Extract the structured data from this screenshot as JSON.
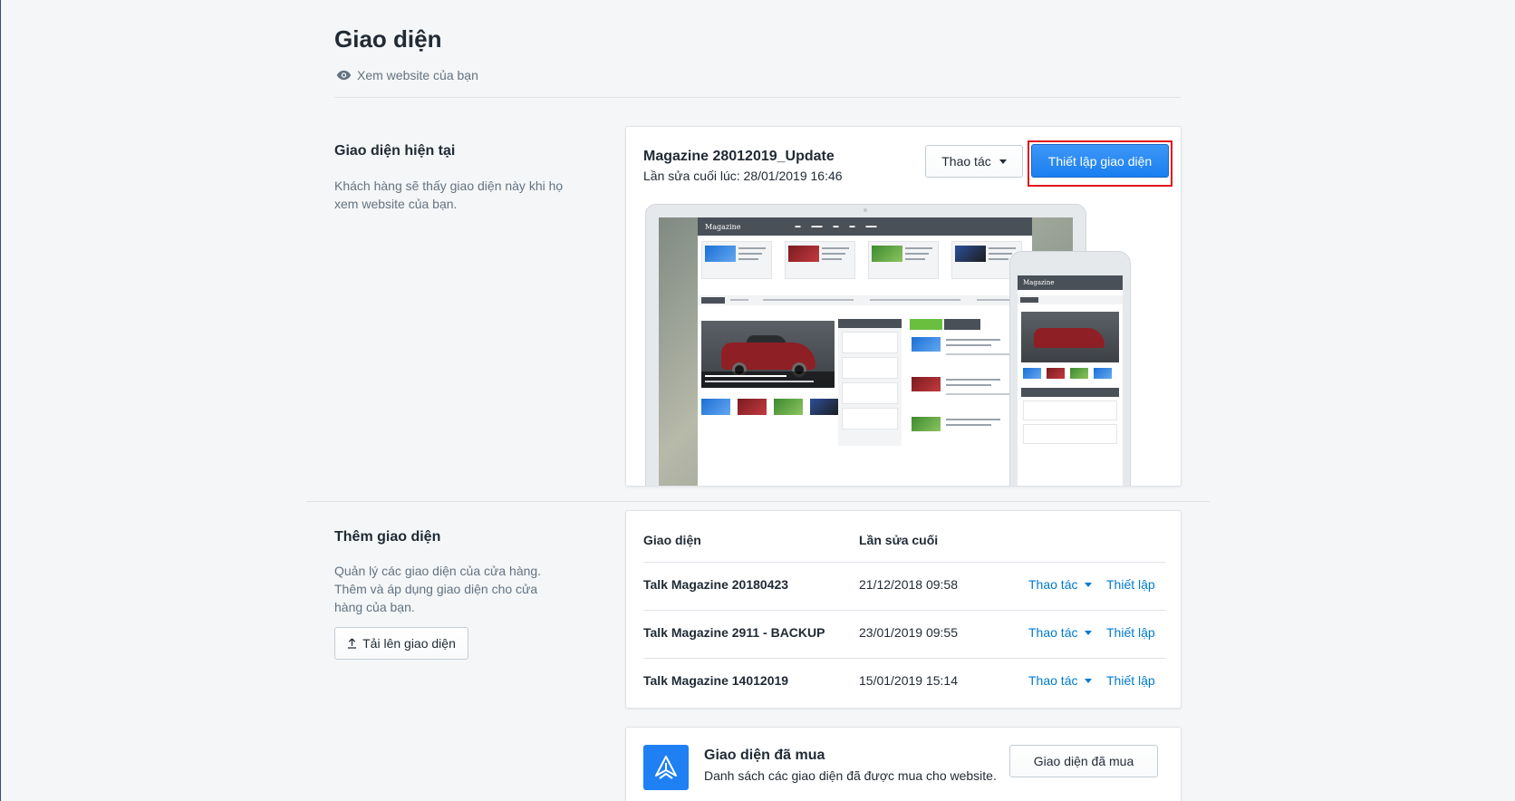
{
  "header": {
    "title": "Giao diện",
    "view_site_label": "Xem website của bạn"
  },
  "current_section": {
    "title": "Giao diện hiện tại",
    "description": "Khách hàng sẽ thấy giao diện này khi họ xem website của bạn."
  },
  "current_theme": {
    "name": "Magazine 28012019_Update",
    "last_edited": "Lần sửa cuối lúc: 28/01/2019 16:46",
    "actions_label": "Thao tác",
    "customize_label": "Thiết lập giao diện",
    "preview_site_name": "Magazine"
  },
  "add_section": {
    "title": "Thêm giao diện",
    "description": "Quản lý các giao diện của cửa hàng. Thêm và áp dụng giao diện cho cửa hàng của bạn.",
    "upload_label": "Tải lên giao diện"
  },
  "themes_table": {
    "col_theme": "Giao diện",
    "col_last_edit": "Lần sửa cuối",
    "action_label": "Thao tác",
    "setup_label": "Thiết lập",
    "rows": [
      {
        "name": "Talk Magazine 20180423",
        "date": "21/12/2018 09:58"
      },
      {
        "name": "Talk Magazine 2911 - BACKUP",
        "date": "23/01/2019 09:55"
      },
      {
        "name": "Talk Magazine 14012019",
        "date": "15/01/2019 15:14"
      }
    ]
  },
  "purchased": {
    "title": "Giao diện đã mua",
    "description": "Danh sách các giao diện đã được mua cho website.",
    "button_label": "Giao diện đã mua"
  },
  "colors": {
    "primary": "#1f80f4",
    "link": "#007ace",
    "highlight": "#e0151d",
    "background": "#f4f6f8"
  }
}
